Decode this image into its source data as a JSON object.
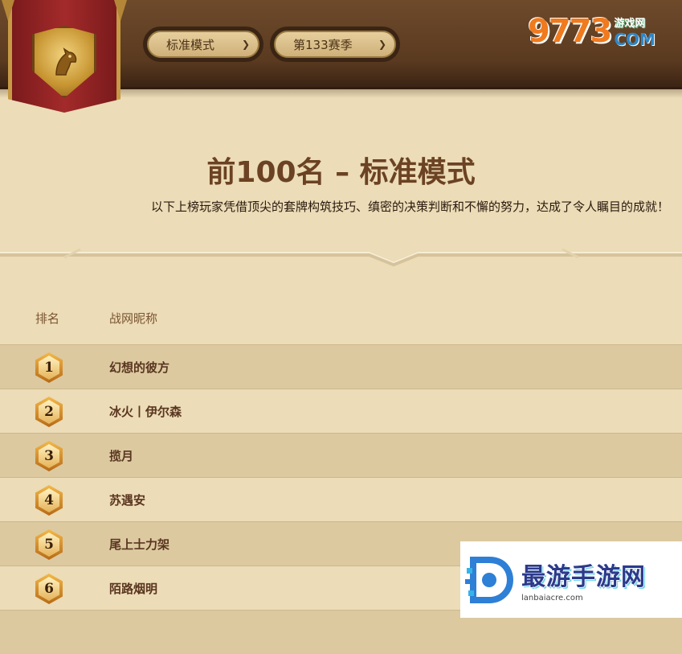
{
  "header": {
    "mode_dropdown": {
      "selected": "标准模式"
    },
    "season_dropdown": {
      "selected": "第133赛季"
    },
    "site_logo": {
      "number": "9773",
      "cn": "游戏网",
      "com": "COM"
    }
  },
  "page": {
    "title": "前100名 – 标准模式",
    "subtitle": "以下上榜玩家凭借顶尖的套牌构筑技巧、缜密的决策判断和不懈的努力，达成了令人瞩目的成就！"
  },
  "table": {
    "columns": [
      "排名",
      "战网昵称"
    ],
    "rows": [
      {
        "rank": "1",
        "name": "幻想的彼方"
      },
      {
        "rank": "2",
        "name": "冰火丨伊尔森"
      },
      {
        "rank": "3",
        "name": "揽月"
      },
      {
        "rank": "4",
        "name": "苏遇安"
      },
      {
        "rank": "5",
        "name": "尾上士力架"
      },
      {
        "rank": "6",
        "name": "陌路烟明"
      }
    ]
  },
  "watermark": {
    "cn": "最游手游网",
    "url": "lanbaiacre.com"
  },
  "colors": {
    "header_brown": "#5a3a20",
    "parchment": "#ecdcb7",
    "row_alt": "#dcc9a0",
    "title_brown": "#6b4223"
  }
}
